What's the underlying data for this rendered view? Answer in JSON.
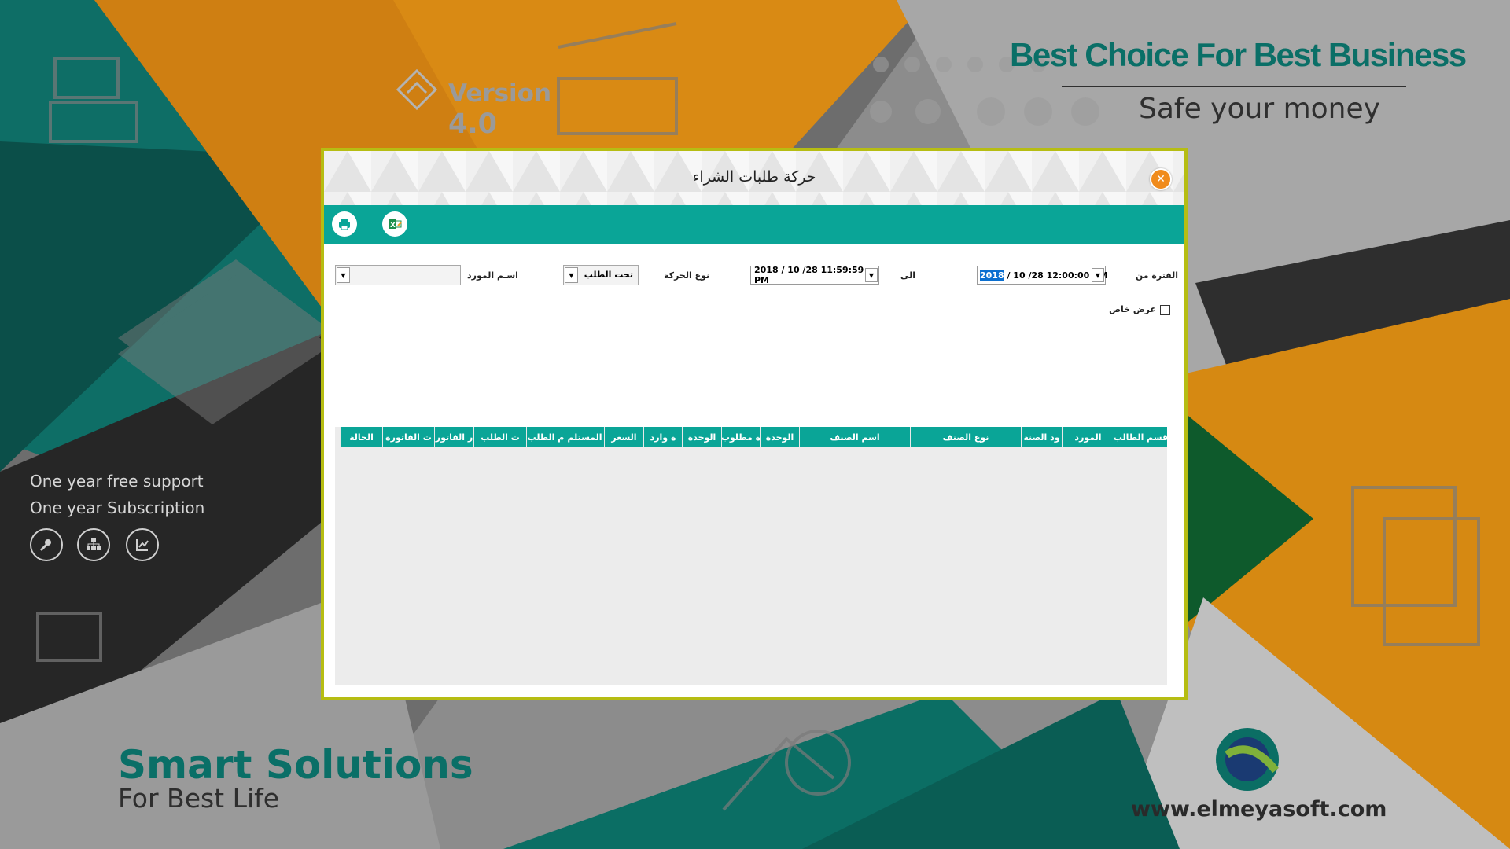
{
  "background": {
    "version_label": "Version",
    "version_number": "4.0",
    "tagline": "Best Choice For Best Business",
    "subtagline": "Safe your money",
    "support_lines": [
      "One year free support",
      "One year Subscription"
    ],
    "bottom_title": "Smart Solutions",
    "bottom_subtitle": "For Best Life",
    "website": "www.elmeyasoft.com",
    "colors": {
      "teal": "#0a6f67",
      "orange": "#d9870f",
      "gray": "#8a8a8a",
      "dark": "#2f2f2f"
    }
  },
  "window": {
    "title": "حركة طلبات الشراء",
    "close_icon": "close-icon",
    "toolbar": {
      "print_icon": "printer-icon",
      "excel_icon": "excel-icon"
    },
    "accent": "#0aa597",
    "border_color": "#b6bd13"
  },
  "filters": {
    "period_from_label": "الفترة من",
    "from_date": "2018 / 10 /28 12:00:00 AM",
    "from_date_year": "2018",
    "from_date_rest": " / 10 /28 12:00:00 AM",
    "to_label": "الى",
    "to_date": "2018 / 10 /28 11:59:59 PM",
    "movement_type_label": "نوع الحركة",
    "movement_type_value": "تحت الطلب",
    "supplier_label": "اسـم  المورد",
    "supplier_value": "",
    "special_view_label": "عرض خاص",
    "special_view_checked": false
  },
  "grid": {
    "columns": [
      "قسم الطالب",
      "المورد",
      "ود الصنة",
      "نوع الصنف",
      "اسم الصنف",
      "الوحدة",
      "ة مطلوب",
      "الوحدة",
      "ة وارد",
      "السعر",
      "المستلم",
      "م الطلب",
      "ت الطلب",
      "ر الفاتور",
      "ت الفاتورة",
      "الحالة"
    ],
    "rows": []
  }
}
